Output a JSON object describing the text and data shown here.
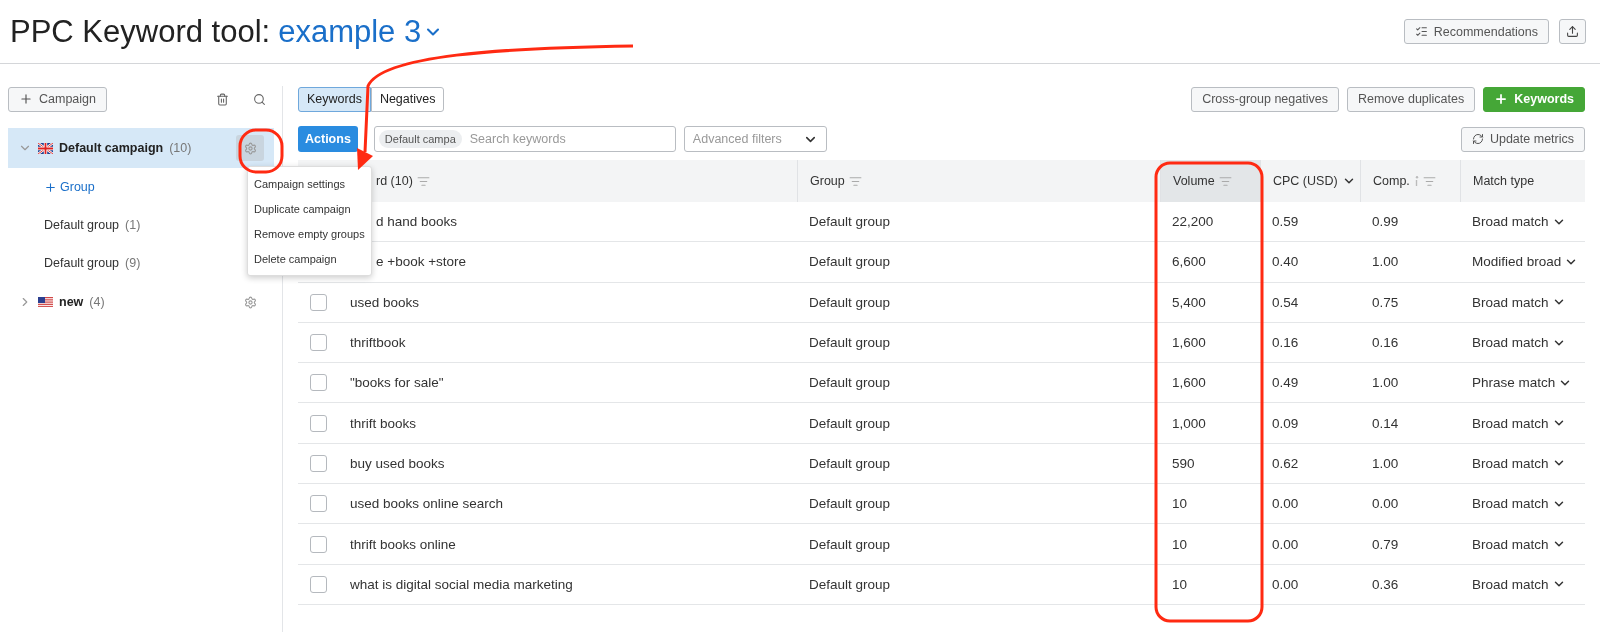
{
  "header": {
    "title": "PPC Keyword tool:",
    "project": "example 3",
    "buttons": [
      {
        "kind": "recommendations",
        "label": "Recommendations"
      },
      {
        "kind": "export"
      }
    ]
  },
  "sidebar": {
    "add_button": "Campaign",
    "campaigns": [
      {
        "kind": "uk",
        "name": "Default campaign",
        "count": "(10)",
        "expanded": true,
        "selected": true,
        "add_group": "Group",
        "children": [
          {
            "name": "Default group",
            "count": "(1)"
          },
          {
            "name": "Default group",
            "count": "(9)"
          }
        ]
      },
      {
        "kind": "us",
        "name": "new",
        "count": "(4)",
        "expanded": false,
        "selected": false
      }
    ]
  },
  "context_menu": {
    "items": [
      "Campaign settings",
      "Duplicate campaign",
      "Remove empty groups",
      "Delete campaign"
    ]
  },
  "tabs": [
    {
      "label": "Keywords",
      "selected": true
    },
    {
      "label": "Negatives",
      "selected": false
    }
  ],
  "toolbar_buttons": [
    {
      "kind": "plain",
      "label": "Cross-group negatives"
    },
    {
      "kind": "plain",
      "label": "Remove duplicates"
    },
    {
      "kind": "primary",
      "label": "Keywords"
    }
  ],
  "actions_button": "Actions",
  "search": {
    "chip": "Default campa",
    "placeholder": "Search keywords"
  },
  "advanced_filters": "Advanced filters",
  "update_metrics": "Update metrics",
  "table": {
    "columns": [
      {
        "label": "rd (10)",
        "kind": "sort"
      },
      {
        "label": "Group",
        "kind": "sort"
      },
      {
        "label": "Volume",
        "kind": "sort",
        "selected": true
      },
      {
        "label": "CPC (USD)",
        "kind": "dropdown",
        "selected": false
      },
      {
        "label": "Comp.",
        "kind": "info_sort",
        "selected": false
      },
      {
        "label": "Match type",
        "kind": "plain",
        "selected": false
      }
    ],
    "rows": [
      {
        "kind": "covered",
        "keyword": "d hand books",
        "group": "Default group",
        "volume": "22,200",
        "cpc": "0.59",
        "comp": "0.99",
        "match": "Broad match"
      },
      {
        "kind": "covered",
        "keyword": "e +book +store",
        "group": "Default group",
        "volume": "6,600",
        "cpc": "0.40",
        "comp": "1.00",
        "match": "Modified broad"
      },
      {
        "kind": "normal",
        "checked": false,
        "keyword": "used books",
        "group": "Default group",
        "volume": "5,400",
        "cpc": "0.54",
        "comp": "0.75",
        "match": "Broad match"
      },
      {
        "kind": "normal",
        "checked": false,
        "keyword": "thriftbook",
        "group": "Default group",
        "volume": "1,600",
        "cpc": "0.16",
        "comp": "0.16",
        "match": "Broad match"
      },
      {
        "kind": "normal",
        "checked": false,
        "keyword": "\"books for sale\"",
        "group": "Default group",
        "volume": "1,600",
        "cpc": "0.49",
        "comp": "1.00",
        "match": "Phrase match"
      },
      {
        "kind": "normal",
        "checked": false,
        "keyword": "thrift books",
        "group": "Default group",
        "volume": "1,000",
        "cpc": "0.09",
        "comp": "0.14",
        "match": "Broad match"
      },
      {
        "kind": "normal",
        "checked": false,
        "keyword": "buy used books",
        "group": "Default group",
        "volume": "590",
        "cpc": "0.62",
        "comp": "1.00",
        "match": "Broad match"
      },
      {
        "kind": "normal",
        "checked": false,
        "keyword": "used books online search",
        "group": "Default group",
        "volume": "10",
        "cpc": "0.00",
        "comp": "0.00",
        "match": "Broad match"
      },
      {
        "kind": "normal",
        "checked": false,
        "keyword": "thrift books online",
        "group": "Default group",
        "volume": "10",
        "cpc": "0.00",
        "comp": "0.79",
        "match": "Broad match"
      },
      {
        "kind": "normal",
        "checked": false,
        "keyword": "what is digital social media marketing",
        "group": "Default group",
        "volume": "10",
        "cpc": "0.00",
        "comp": "0.36",
        "match": "Broad match"
      }
    ]
  }
}
